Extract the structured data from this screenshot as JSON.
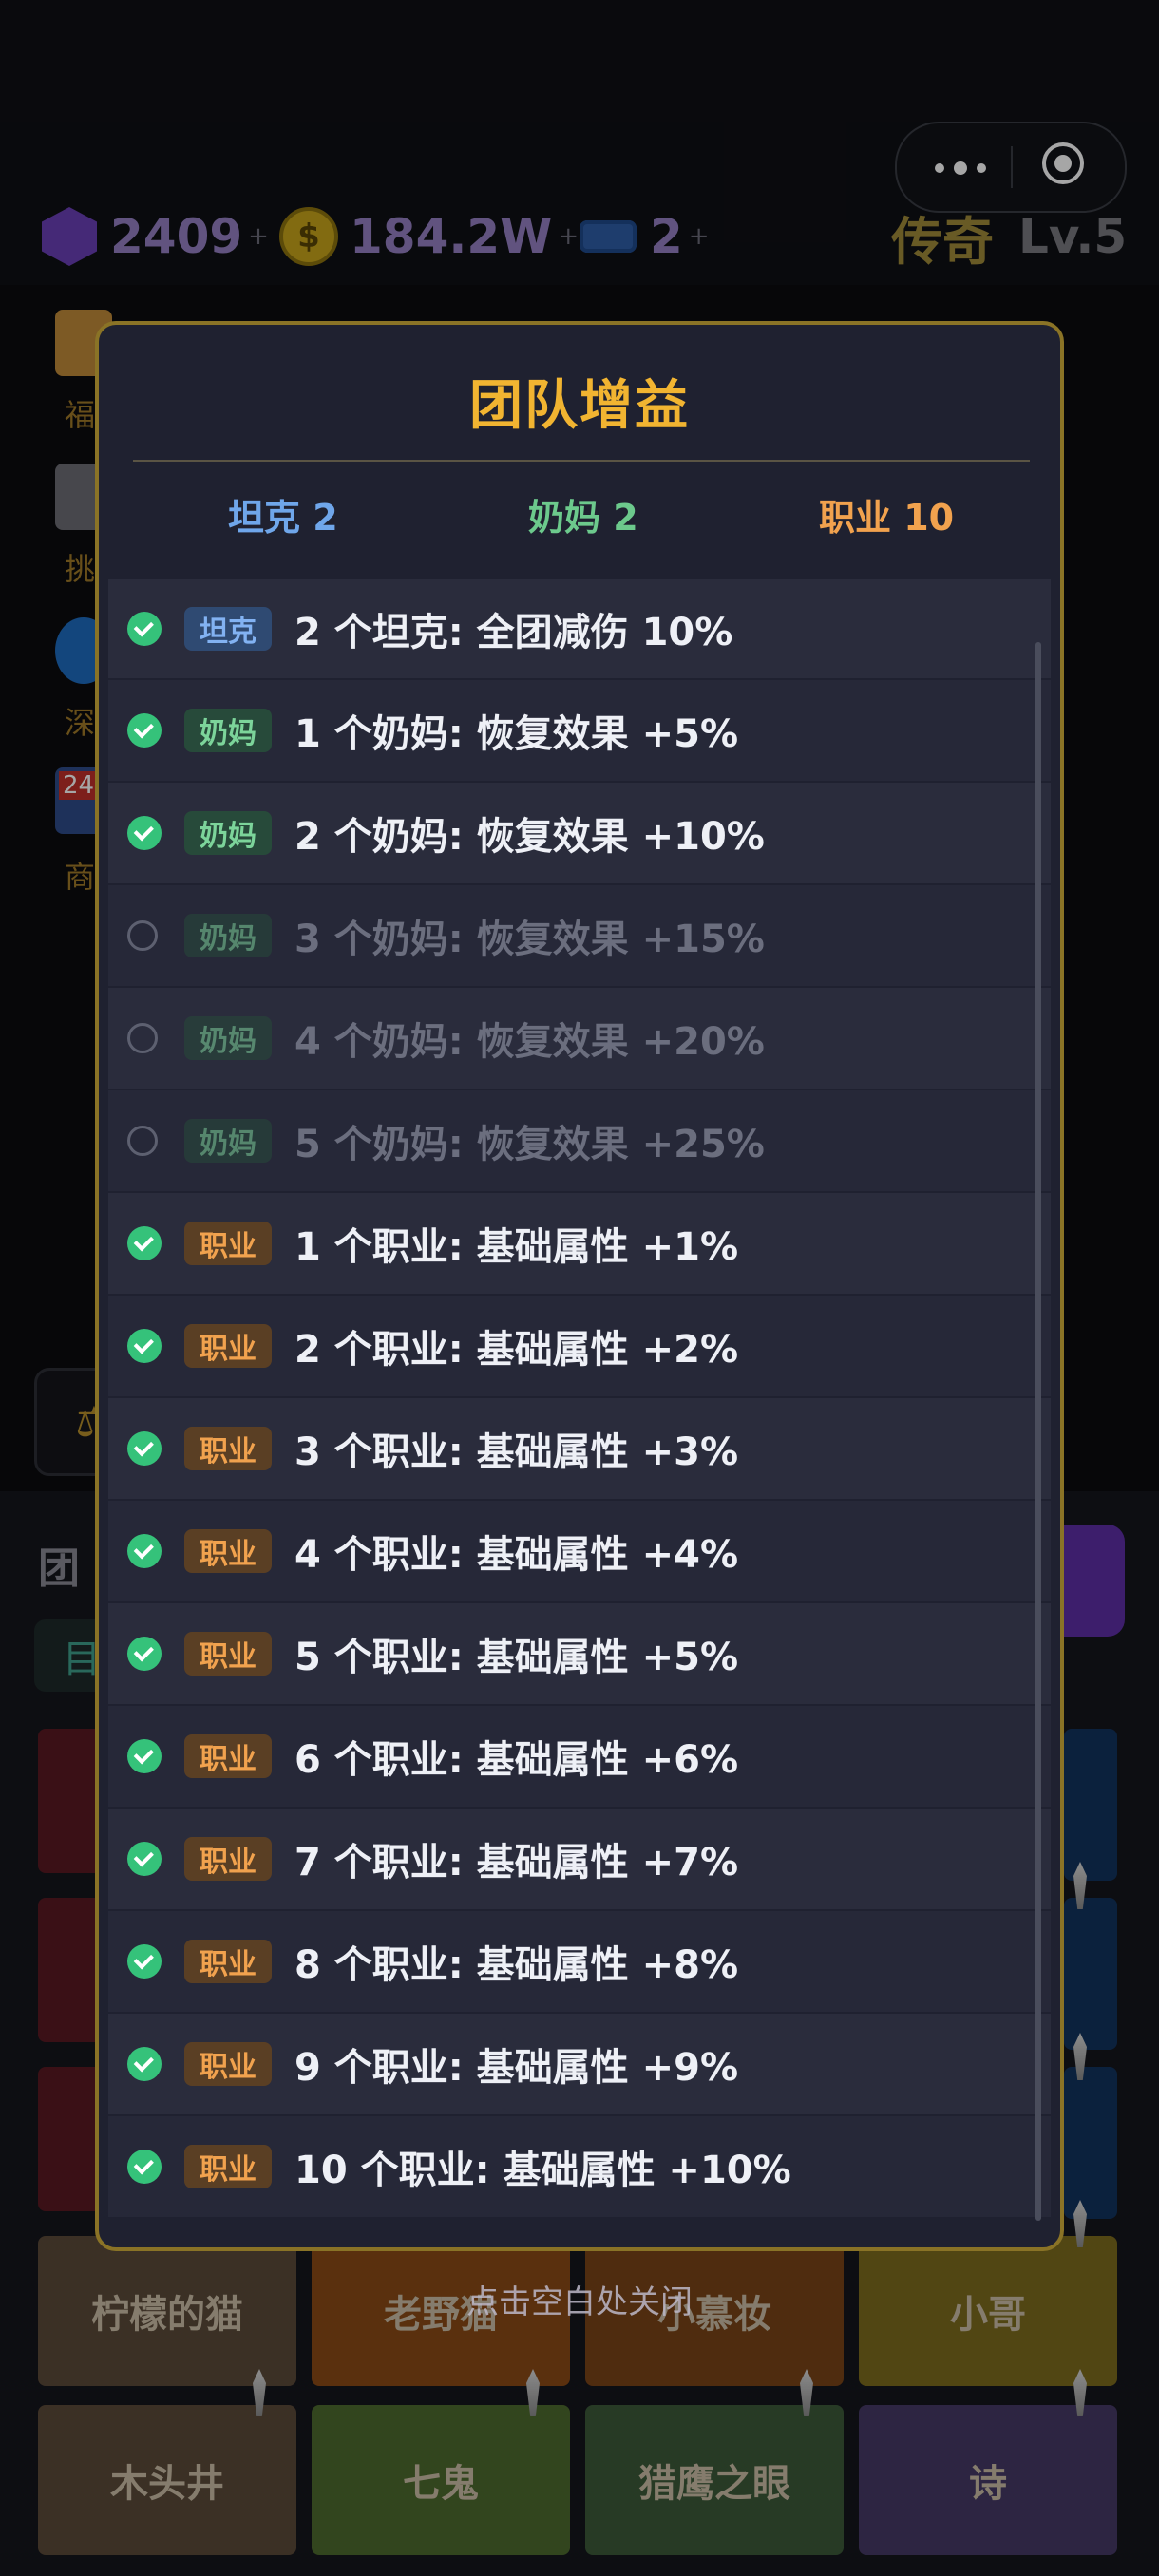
{
  "top_bar": {
    "gems": "2409",
    "coins": "184.2W",
    "tickets": "2",
    "plus": "+",
    "rank_title": "传奇",
    "level": "Lv.5",
    "coin_symbol": "$"
  },
  "side_menu": [
    {
      "label": "福",
      "icon": "gift-icon"
    },
    {
      "label": "挑",
      "icon": "sword-icon"
    },
    {
      "label": "深",
      "icon": "vortex-icon"
    },
    {
      "label": "商",
      "icon": "shop-icon",
      "badge": "24"
    }
  ],
  "lower": {
    "team_label": "团",
    "tab_chip": "目"
  },
  "cards": {
    "row1": [
      "柠檬的猫",
      "老野猫",
      "小慕妆",
      "小哥"
    ],
    "row2": [
      "木头井",
      "七鬼",
      "猎鹰之眼",
      "诗"
    ]
  },
  "close_hint": "点击空白处关闭",
  "modal": {
    "title": "团队增益",
    "summary": {
      "tank": "坦克 2",
      "heal": "奶妈 2",
      "job": "职业 10"
    },
    "rows": [
      {
        "tag": "坦克",
        "type": "tank",
        "active": true,
        "text": "2 个坦克: 全团减伤 10%"
      },
      {
        "tag": "奶妈",
        "type": "heal",
        "active": true,
        "text": "1 个奶妈: 恢复效果 +5%"
      },
      {
        "tag": "奶妈",
        "type": "heal",
        "active": true,
        "text": "2 个奶妈: 恢复效果 +10%"
      },
      {
        "tag": "奶妈",
        "type": "heal",
        "active": false,
        "text": "3 个奶妈: 恢复效果 +15%"
      },
      {
        "tag": "奶妈",
        "type": "heal",
        "active": false,
        "text": "4 个奶妈: 恢复效果 +20%"
      },
      {
        "tag": "奶妈",
        "type": "heal",
        "active": false,
        "text": "5 个奶妈: 恢复效果 +25%"
      },
      {
        "tag": "职业",
        "type": "job",
        "active": true,
        "text": "1 个职业: 基础属性 +1%"
      },
      {
        "tag": "职业",
        "type": "job",
        "active": true,
        "text": "2 个职业: 基础属性 +2%"
      },
      {
        "tag": "职业",
        "type": "job",
        "active": true,
        "text": "3 个职业: 基础属性 +3%"
      },
      {
        "tag": "职业",
        "type": "job",
        "active": true,
        "text": "4 个职业: 基础属性 +4%"
      },
      {
        "tag": "职业",
        "type": "job",
        "active": true,
        "text": "5 个职业: 基础属性 +5%"
      },
      {
        "tag": "职业",
        "type": "job",
        "active": true,
        "text": "6 个职业: 基础属性 +6%"
      },
      {
        "tag": "职业",
        "type": "job",
        "active": true,
        "text": "7 个职业: 基础属性 +7%"
      },
      {
        "tag": "职业",
        "type": "job",
        "active": true,
        "text": "8 个职业: 基础属性 +8%"
      },
      {
        "tag": "职业",
        "type": "job",
        "active": true,
        "text": "9 个职业: 基础属性 +9%"
      },
      {
        "tag": "职业",
        "type": "job",
        "active": true,
        "text": "10 个职业: 基础属性 +10%"
      }
    ]
  },
  "colors": {
    "accent_gold": "#f1b431",
    "tank_blue": "#6fa6ea",
    "heal_green": "#6cc98c",
    "job_orange": "#f1a24e",
    "check_green": "#35c27a"
  }
}
